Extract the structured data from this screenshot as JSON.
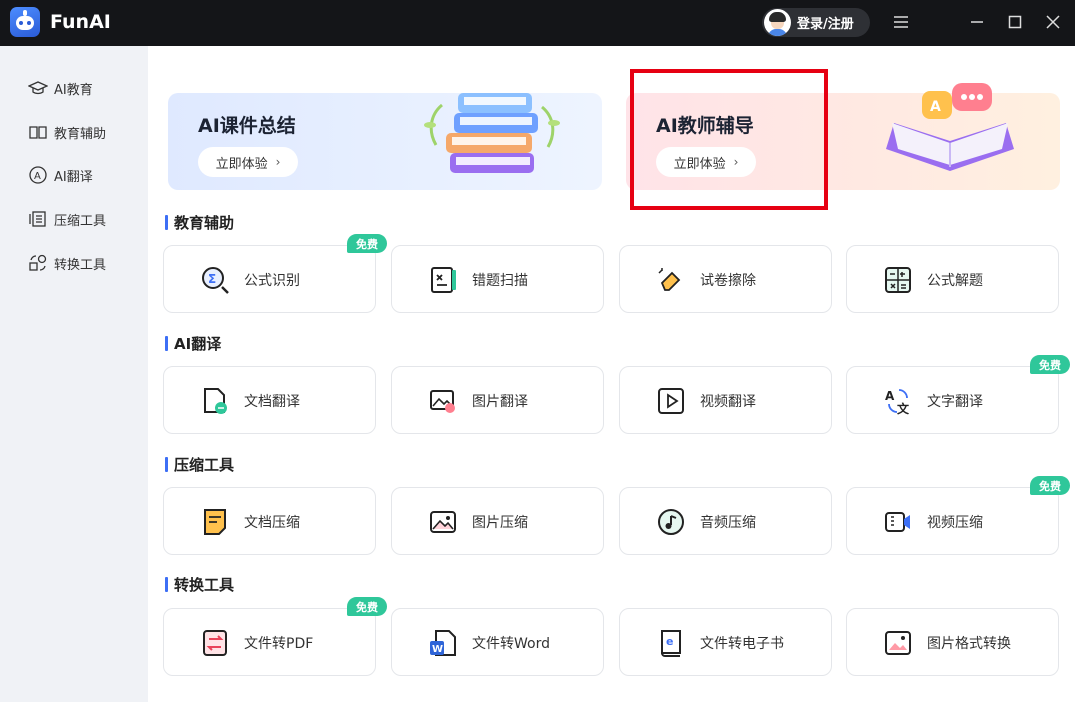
{
  "app": {
    "title": "FunAI",
    "login_label": "登录/注册"
  },
  "sidebar": {
    "items": [
      {
        "label": "AI教育",
        "icon": "graduation-cap-icon"
      },
      {
        "label": "教育辅助",
        "icon": "book-icon"
      },
      {
        "label": "AI翻译",
        "icon": "translate-icon"
      },
      {
        "label": "压缩工具",
        "icon": "compress-icon"
      },
      {
        "label": "转换工具",
        "icon": "convert-icon"
      }
    ]
  },
  "banners": [
    {
      "title": "AI课件总结",
      "button": "立即体验",
      "chevron": "›"
    },
    {
      "title": "AI教师辅导",
      "button": "立即体验",
      "chevron": "›"
    }
  ],
  "sections": [
    {
      "title": "教育辅助",
      "cards": [
        {
          "label": "公式识别",
          "icon": "formula-scan-icon",
          "badge": "免费"
        },
        {
          "label": "错题扫描",
          "icon": "notebook-scan-icon"
        },
        {
          "label": "试卷擦除",
          "icon": "eraser-icon"
        },
        {
          "label": "公式解题",
          "icon": "calculator-icon"
        }
      ]
    },
    {
      "title": "AI翻译",
      "cards": [
        {
          "label": "文档翻译",
          "icon": "doc-translate-icon"
        },
        {
          "label": "图片翻译",
          "icon": "image-translate-icon"
        },
        {
          "label": "视频翻译",
          "icon": "video-play-icon"
        },
        {
          "label": "文字翻译",
          "icon": "text-translate-icon",
          "badge": "免费"
        }
      ]
    },
    {
      "title": "压缩工具",
      "cards": [
        {
          "label": "文档压缩",
          "icon": "doc-compress-icon"
        },
        {
          "label": "图片压缩",
          "icon": "image-compress-icon"
        },
        {
          "label": "音频压缩",
          "icon": "music-disc-icon"
        },
        {
          "label": "视频压缩",
          "icon": "video-camera-icon",
          "badge": "免费"
        }
      ]
    },
    {
      "title": "转换工具",
      "cards": [
        {
          "label": "文件转PDF",
          "icon": "pdf-convert-icon",
          "badge": "免费"
        },
        {
          "label": "文件转Word",
          "icon": "word-icon"
        },
        {
          "label": "文件转电子书",
          "icon": "ebook-icon"
        },
        {
          "label": "图片格式转换",
          "icon": "image-format-icon"
        }
      ]
    }
  ],
  "colors": {
    "accent": "#3d6ff5",
    "badge": "#2fc79a",
    "highlight": "#e60012",
    "titlebar": "#141518"
  }
}
